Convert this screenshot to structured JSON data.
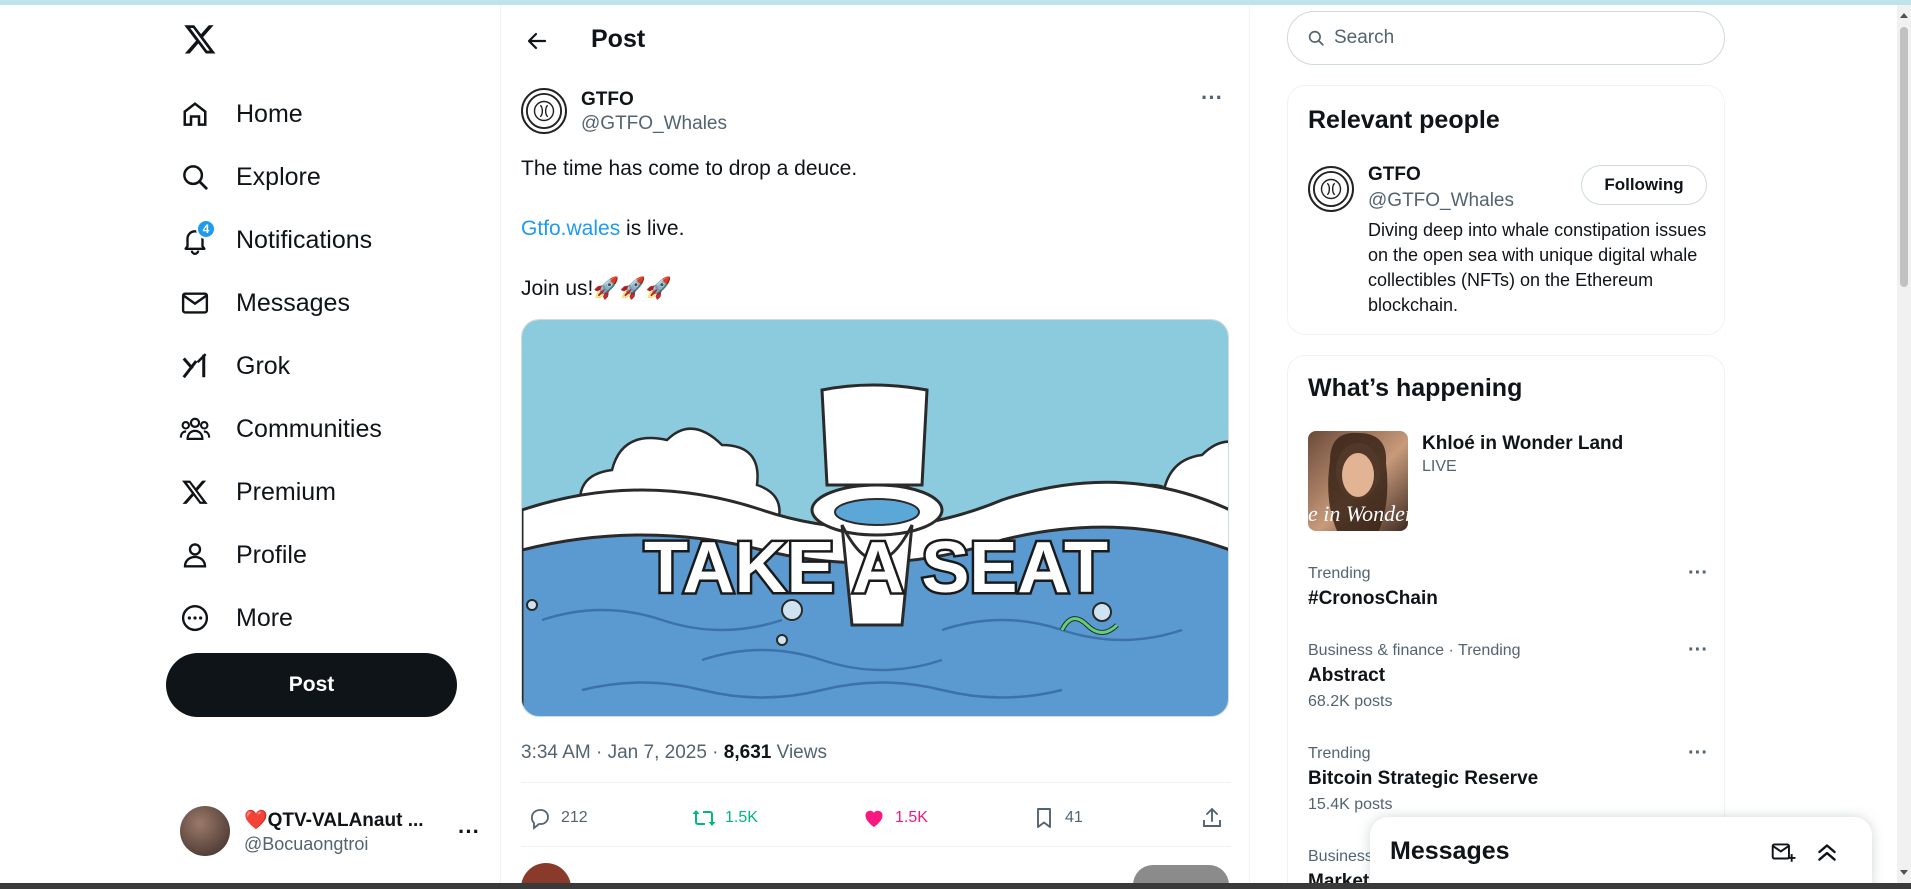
{
  "nav": {
    "items": [
      {
        "label": "Home",
        "icon": "home-icon"
      },
      {
        "label": "Explore",
        "icon": "search-icon"
      },
      {
        "label": "Notifications",
        "icon": "bell-icon",
        "badge": "4"
      },
      {
        "label": "Messages",
        "icon": "envelope-icon"
      },
      {
        "label": "Grok",
        "icon": "grok-icon"
      },
      {
        "label": "Communities",
        "icon": "people-icon"
      },
      {
        "label": "Premium",
        "icon": "x-logo-icon"
      },
      {
        "label": "Profile",
        "icon": "person-icon"
      },
      {
        "label": "More",
        "icon": "more-circle-icon"
      }
    ],
    "post_button": "Post"
  },
  "account": {
    "name": "❤️QTV-VALAnaut ...",
    "handle": "@Bocuaongtroi"
  },
  "header": {
    "title": "Post"
  },
  "post": {
    "author_name": "GTFO",
    "author_handle": "@GTFO_Whales",
    "line1": "The time has come to drop a deuce.",
    "link": "Gtfo.wales",
    "line2_rest": " is live.",
    "line3": "Join us!🚀🚀🚀",
    "media_caption": "TAKE A SEAT",
    "time": "3:34 AM · Jan 7, 2025 · ",
    "views_count": "8,631",
    "views_label": " Views",
    "replies": "212",
    "reposts": "1.5K",
    "likes": "1.5K",
    "bookmarks": "41"
  },
  "search": {
    "placeholder": "Search"
  },
  "relevant": {
    "title": "Relevant people",
    "name": "GTFO",
    "handle": "@GTFO_Whales",
    "follow_label": "Following",
    "bio": "Diving deep into whale constipation issues on the open sea with unique digital whale collectibles (NFTs) on the Ethereum blockchain."
  },
  "happening": {
    "title": "What’s happening",
    "live_title": "Khloé in Wonder Land",
    "live_label": "LIVE",
    "live_thumb_text": "e in Wonderl",
    "trends": [
      {
        "context": "Trending",
        "name": "#CronosChain",
        "count": ""
      },
      {
        "context": "Business & finance · Trending",
        "name": "Abstract",
        "count": "68.2K posts"
      },
      {
        "context": "Trending",
        "name": "Bitcoin Strategic Reserve",
        "count": "15.4K posts"
      },
      {
        "context": "Business",
        "name": "Market",
        "count": ""
      }
    ]
  },
  "messages_drawer": {
    "title": "Messages"
  },
  "colors": {
    "accent": "#1d9bf0",
    "repost": "#00ba7c",
    "like": "#f91880",
    "text": "#0f1419",
    "muted": "#536471"
  }
}
